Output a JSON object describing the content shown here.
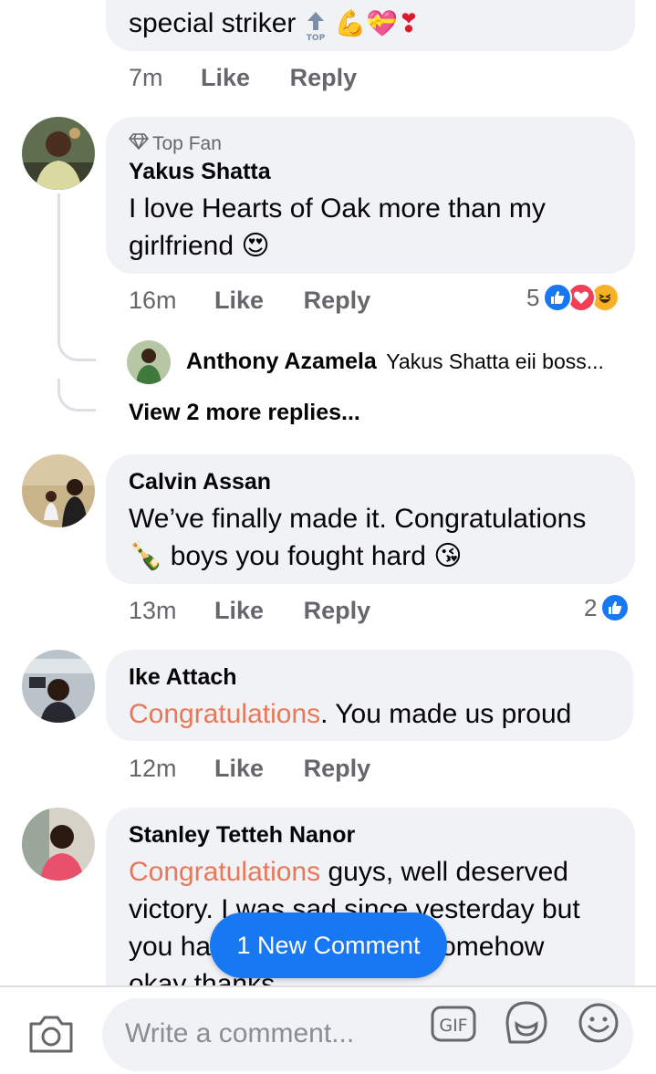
{
  "comments": [
    {
      "id": "c0",
      "text_tail": "special striker",
      "emoji_tail": "⬆ 💪💝❣️",
      "time": "7m",
      "like_label": "Like",
      "reply_label": "Reply"
    },
    {
      "id": "c1",
      "badge": "Top Fan",
      "author": "Yakus Shatta",
      "text": "I love Hearts of Oak more than my girlfriend 😍",
      "time": "16m",
      "like_label": "Like",
      "reply_label": "Reply",
      "reaction_count": "5",
      "reply": {
        "author": "Anthony Azamela",
        "text": "Yakus Shatta eii boss..."
      },
      "more_replies": "View 2 more replies..."
    },
    {
      "id": "c2",
      "author": "Calvin Assan",
      "text_line1": "We’ve finally made it. Congratulations",
      "text_line2": "🍾 boys you fought hard 😘",
      "time": "13m",
      "like_label": "Like",
      "reply_label": "Reply",
      "reaction_count": "2"
    },
    {
      "id": "c3",
      "author": "Ike Attach",
      "highlight": "Congratulations",
      "text_rest": ". You made us proud",
      "time": "12m",
      "like_label": "Like",
      "reply_label": "Reply"
    },
    {
      "id": "c4",
      "author": "Stanley Tetteh Nanor",
      "highlight": "Congratulations",
      "line1_rest": " guys, well deserved",
      "line2": "victory. I was sad since yesterday but",
      "line3a": "you ha",
      "line3b": "omehow",
      "line4": "okay thanks"
    }
  ],
  "new_comment_pill": "1 New Comment",
  "composer": {
    "placeholder": "Write a comment...",
    "gif_label": "GIF"
  },
  "colors": {
    "bubble": "#f0f2f5",
    "highlight": "#e8785a",
    "meta": "#65676b",
    "like_blue": "#1877f2",
    "love_red": "#f33e58",
    "haha_yellow": "#f7b125"
  }
}
